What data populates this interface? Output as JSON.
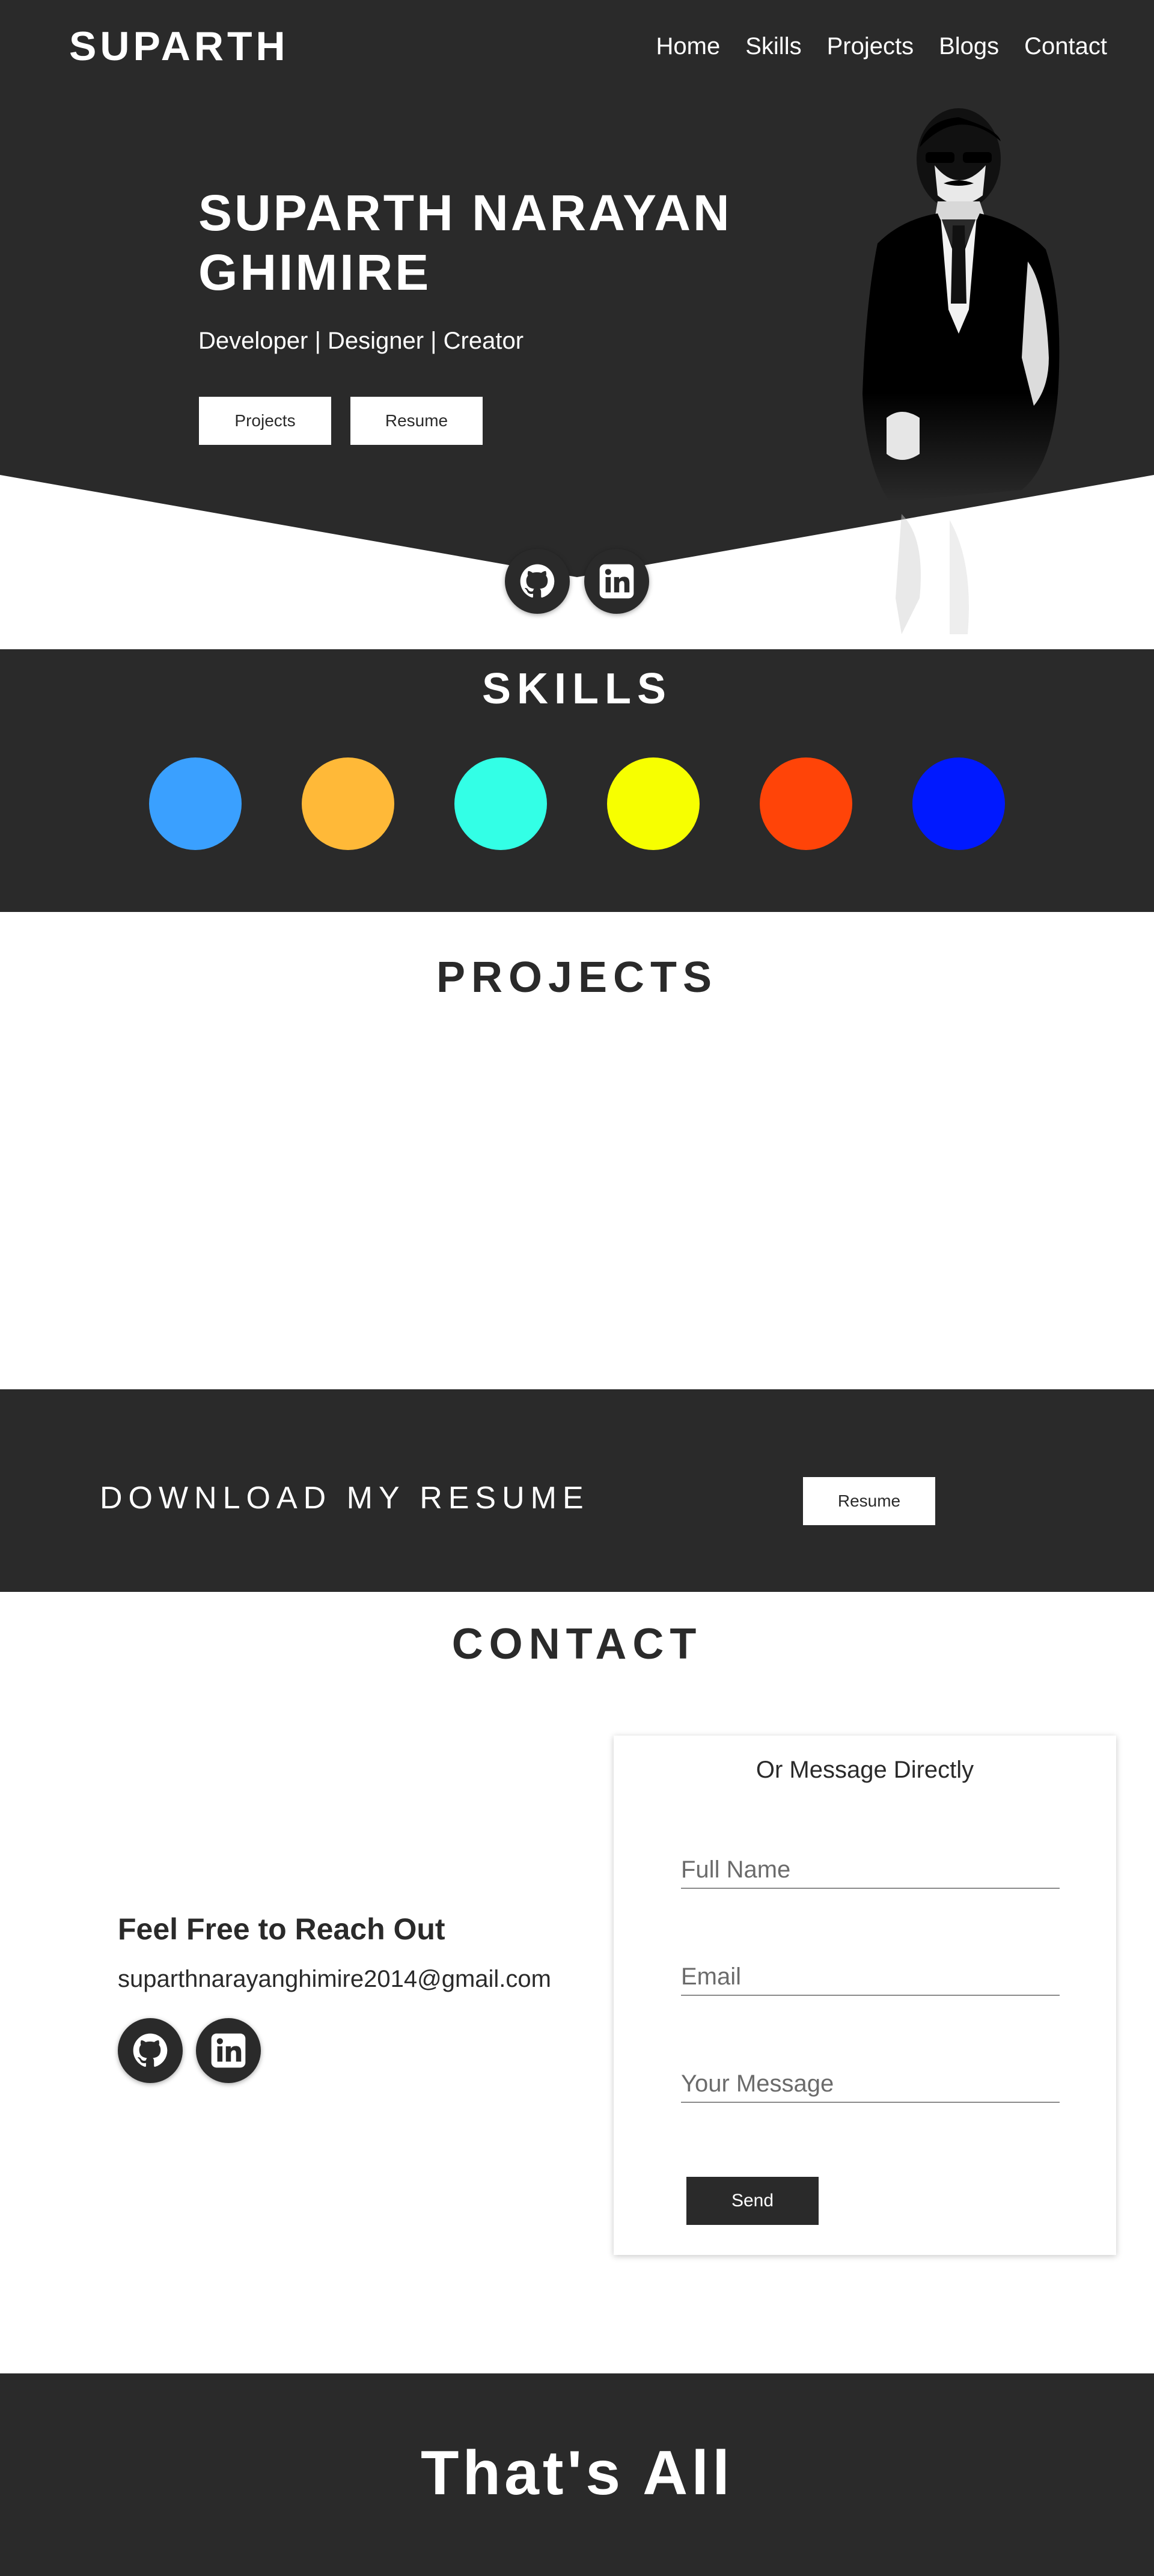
{
  "header": {
    "brand": "SUPARTH",
    "nav": [
      "Home",
      "Skills",
      "Projects",
      "Blogs",
      "Contact"
    ]
  },
  "hero": {
    "name": "SUPARTH NARAYAN GHIMIRE",
    "tagline": "Developer | Designer | Creator",
    "projects_button": "Projects",
    "resume_button": "Resume"
  },
  "skills": {
    "title": "SKILLS",
    "colors": [
      "#3aa0ff",
      "#ffb938",
      "#33ffe6",
      "#f7ff00",
      "#ff4408",
      "#0019ff"
    ]
  },
  "projects": {
    "title": "PROJECTS"
  },
  "resume_band": {
    "text": "DOWNLOAD MY RESUME",
    "button": "Resume"
  },
  "contact": {
    "title": "CONTACT",
    "reach_out": "Feel Free to Reach Out",
    "email": "suparthnarayanghimire2014@gmail.com",
    "form": {
      "heading": "Or Message Directly",
      "name_placeholder": "Full Name",
      "email_placeholder": "Email",
      "message_placeholder": "Your Message",
      "send_button": "Send"
    }
  },
  "footer": {
    "text": "That's All"
  },
  "icons": {
    "github": "github-icon",
    "linkedin": "linkedin-icon"
  },
  "theme": {
    "dark": "#2a2a2a",
    "light": "#ffffff"
  }
}
